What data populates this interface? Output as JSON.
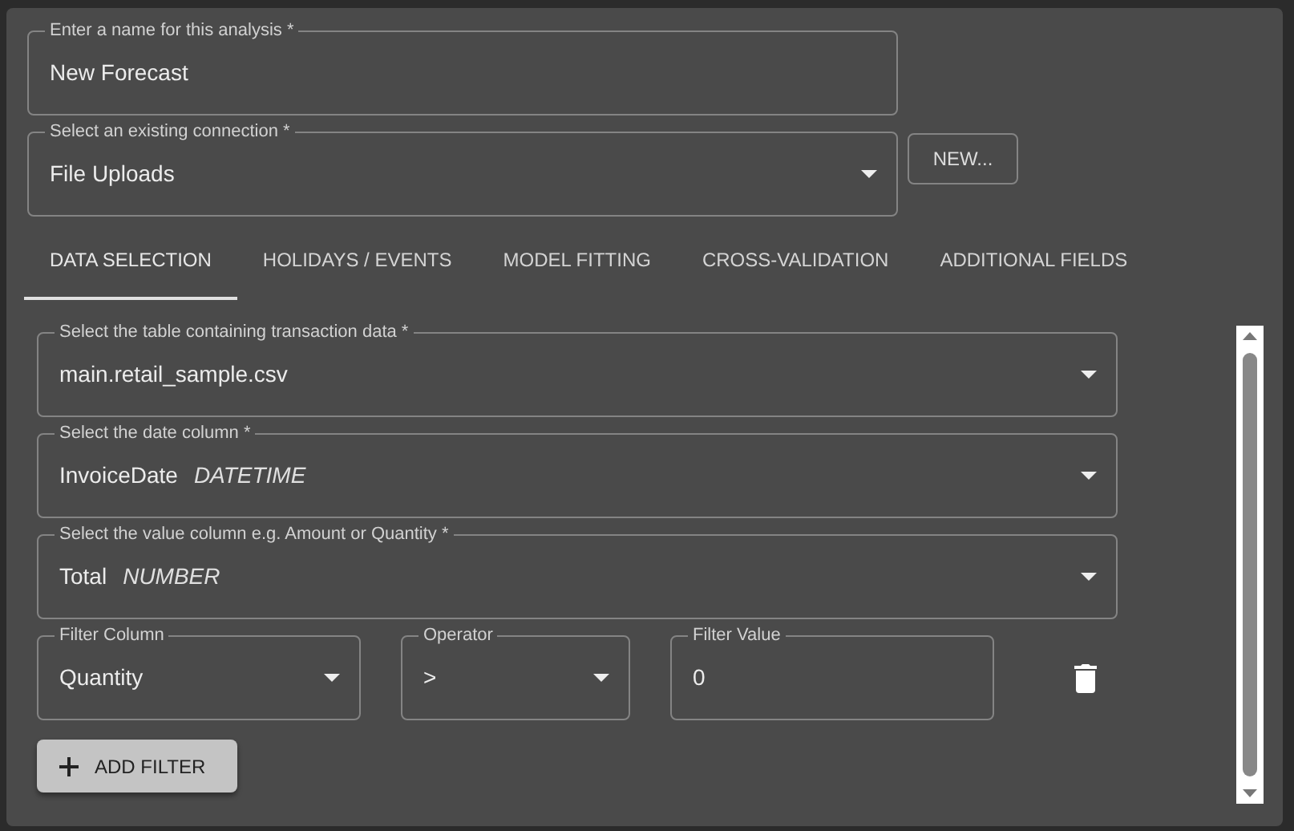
{
  "name_field": {
    "label": "Enter a name for this analysis *",
    "value": "New Forecast"
  },
  "connection_field": {
    "label": "Select an existing connection *",
    "value": "File Uploads",
    "kind": "select"
  },
  "new_button": {
    "label": "NEW..."
  },
  "tabs": [
    {
      "label": "DATA SELECTION",
      "selected": true
    },
    {
      "label": "HOLIDAYS / EVENTS",
      "selected": false
    },
    {
      "label": "MODEL FITTING",
      "selected": false
    },
    {
      "label": "CROSS-VALIDATION",
      "selected": false
    },
    {
      "label": "ADDITIONAL FIELDS",
      "selected": false
    }
  ],
  "data_fields": [
    {
      "label": "Select the table containing transaction data *",
      "value": "main.retail_sample.csv",
      "kind": "select"
    },
    {
      "label": "Select the date column *",
      "value": "InvoiceDate",
      "type_hint": "DATETIME",
      "kind": "select"
    },
    {
      "label": "Select the value column e.g. Amount or Quantity *",
      "value": "Total",
      "type_hint": "NUMBER",
      "kind": "select"
    }
  ],
  "filter": {
    "column": {
      "label": "Filter Column",
      "value": "Quantity",
      "kind": "select"
    },
    "operator": {
      "label": "Operator",
      "value": ">",
      "kind": "select"
    },
    "value": {
      "label": "Filter Value",
      "value": "0"
    }
  },
  "add_filter_button": {
    "label": "ADD FILTER"
  }
}
